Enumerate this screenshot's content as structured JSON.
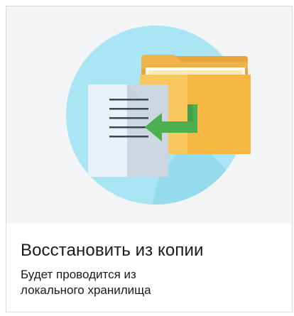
{
  "card": {
    "title": "Восстановить из копии",
    "description_lines": [
      "Будет проводится из",
      "локального хранилища"
    ],
    "illustration_icon": "restore-from-backup-icon",
    "colors": {
      "hero_background": "#f2f4f6",
      "circle": "#a9e5f2",
      "folder": "#f6b843",
      "folder_back": "#f8c75e",
      "document": "#e8f0f7",
      "arrow": "#4caf50"
    }
  }
}
